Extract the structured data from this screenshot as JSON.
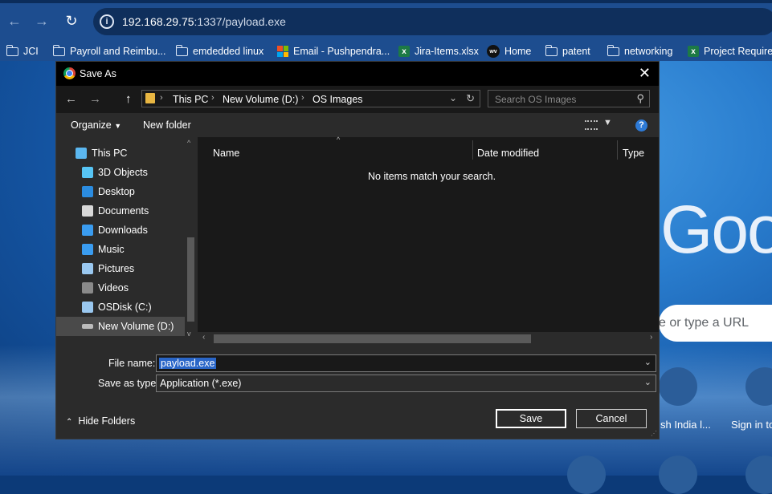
{
  "browser": {
    "url_host": "192.168.29.75",
    "url_rest": ":1337/payload.exe",
    "bookmarks": [
      {
        "label": "JCI",
        "icon": "folder-icon"
      },
      {
        "label": "Payroll and Reimbu...",
        "icon": "folder-icon"
      },
      {
        "label": "emdedded linux",
        "icon": "folder-icon"
      },
      {
        "label": "Email - Pushpendra...",
        "icon": "microsoft-icon"
      },
      {
        "label": "Jira-Items.xlsx",
        "icon": "excel-icon"
      },
      {
        "label": "Home",
        "icon": "wv-icon"
      },
      {
        "label": "patent",
        "icon": "folder-icon"
      },
      {
        "label": "networking",
        "icon": "folder-icon"
      },
      {
        "label": "Project Requirem",
        "icon": "excel-icon"
      }
    ]
  },
  "page": {
    "logo_text": "Goo",
    "search_placeholder": "e or type a URL",
    "tiles": [
      {
        "label": "sh India l..."
      },
      {
        "label": "Sign in to"
      }
    ]
  },
  "dialog": {
    "title": "Save As",
    "breadcrumb": [
      "This PC",
      "New Volume (D:)",
      "OS Images"
    ],
    "search_placeholder": "Search OS Images",
    "toolbar": {
      "organize": "Organize",
      "new_folder": "New folder"
    },
    "nav_items": [
      {
        "label": "This PC",
        "icon": "pc-icon",
        "color": "#5bb7f0",
        "selected": false,
        "indent": 0
      },
      {
        "label": "3D Objects",
        "icon": "cube-icon",
        "color": "#57c5f5",
        "selected": false,
        "indent": 1
      },
      {
        "label": "Desktop",
        "icon": "desktop-icon",
        "color": "#2b8ce0",
        "selected": false,
        "indent": 1
      },
      {
        "label": "Documents",
        "icon": "document-icon",
        "color": "#d8d8d8",
        "selected": false,
        "indent": 1
      },
      {
        "label": "Downloads",
        "icon": "download-icon",
        "color": "#3a9cf0",
        "selected": false,
        "indent": 1
      },
      {
        "label": "Music",
        "icon": "music-icon",
        "color": "#3a9cf0",
        "selected": false,
        "indent": 1
      },
      {
        "label": "Pictures",
        "icon": "picture-icon",
        "color": "#9ac8f0",
        "selected": false,
        "indent": 1
      },
      {
        "label": "Videos",
        "icon": "video-icon",
        "color": "#8a8a8a",
        "selected": false,
        "indent": 1
      },
      {
        "label": "OSDisk (C:)",
        "icon": "windows-drive-icon",
        "color": "#9ac8f0",
        "selected": false,
        "indent": 1
      },
      {
        "label": "New Volume (D:)",
        "icon": "drive-icon",
        "color": "#bbbbbb",
        "selected": true,
        "indent": 1
      }
    ],
    "columns": {
      "name": "Name",
      "date_modified": "Date modified",
      "type": "Type"
    },
    "empty_message": "No items match your search.",
    "file_name_label": "File name:",
    "file_name_value": "payload.exe",
    "save_as_type_label": "Save as type:",
    "save_as_type_value": "Application (*.exe)",
    "hide_folders": "Hide Folders",
    "save_button": "Save",
    "cancel_button": "Cancel"
  },
  "colors": {
    "accent": "#2a66c8",
    "help": "#2d7ad6"
  }
}
